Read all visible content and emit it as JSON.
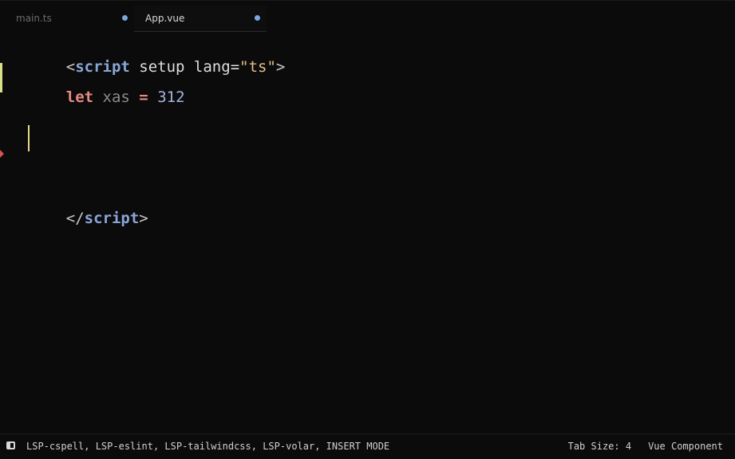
{
  "tabs": [
    {
      "label": "main.ts",
      "dot_color": "#7aa7e0"
    },
    {
      "label": "App.vue",
      "dot_color": "#7aa7e0"
    }
  ],
  "editor": {
    "line1": {
      "open": "<",
      "tag": "script",
      "attr": " setup lang=",
      "value": "\"ts\"",
      "close": ">"
    },
    "line2": {
      "keyword": "let",
      "name": " xas ",
      "op": "=",
      "number": " 312"
    },
    "line5": {
      "open": "</",
      "tag": "script",
      "close": ">"
    }
  },
  "colors": {
    "modified_gutter": "#d9e08a",
    "diagnostic_marker": "#d9534f",
    "caret": "#e6d98a"
  },
  "statusbar": {
    "toggle_icon": "sidebar-toggle-icon",
    "left_text": "LSP-cspell, LSP-eslint, LSP-tailwindcss, LSP-volar, INSERT MODE",
    "tab_size": "Tab Size: 4",
    "syntax": "Vue Component"
  }
}
